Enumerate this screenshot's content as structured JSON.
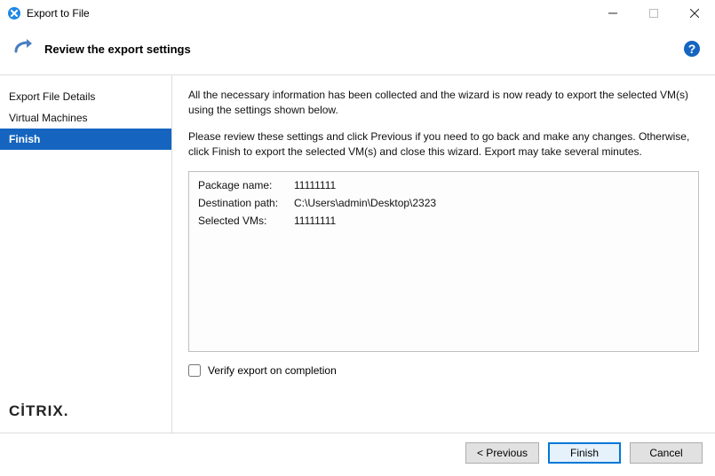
{
  "window": {
    "title": "Export to File"
  },
  "header": {
    "heading": "Review the export settings"
  },
  "sidebar": {
    "steps": [
      {
        "label": "Export File Details"
      },
      {
        "label": "Virtual Machines"
      },
      {
        "label": "Finish"
      }
    ],
    "brand": "CİTRIX"
  },
  "content": {
    "intro1": "All the necessary information has been collected and the wizard is now ready to export the selected VM(s) using the settings shown below.",
    "intro2": "Please review these settings and click Previous if you need to go back and make any changes. Otherwise, click Finish to export the selected VM(s) and close this wizard. Export may take several minutes.",
    "summary": {
      "package_name_label": "Package name:",
      "package_name_value": "11111111",
      "destination_label": "Destination path:",
      "destination_value": "C:\\Users\\admin\\Desktop\\2323",
      "selected_vms_label": "Selected VMs:",
      "selected_vms_value": "11111111"
    },
    "verify_label": "Verify export on completion"
  },
  "footer": {
    "previous": "< Previous",
    "finish": "Finish",
    "cancel": "Cancel"
  }
}
